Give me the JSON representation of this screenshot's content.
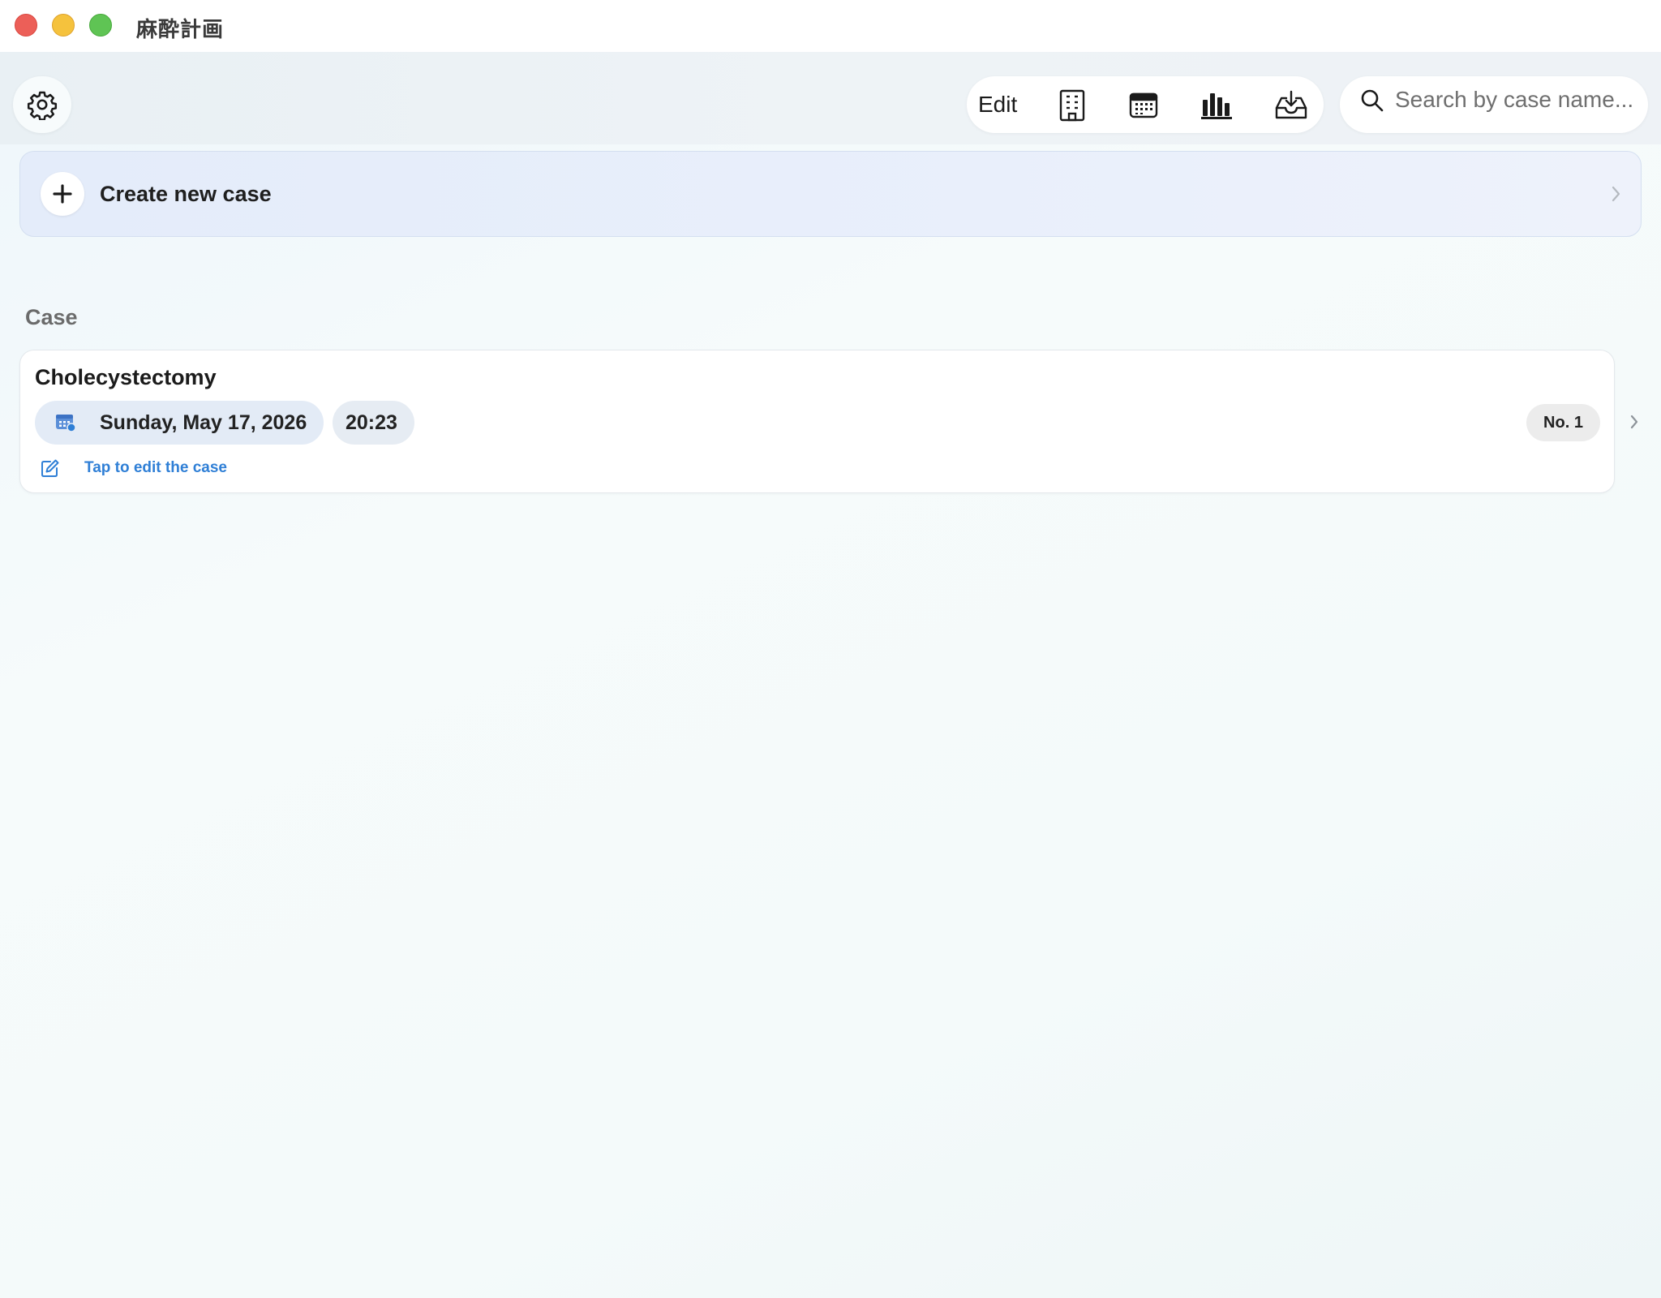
{
  "window": {
    "title": "麻酔計画"
  },
  "toolbar": {
    "edit_label": "Edit",
    "icons": [
      "settings-gear-icon",
      "building-icon",
      "calendar-icon",
      "bar-chart-icon",
      "inbox-download-icon"
    ]
  },
  "search": {
    "placeholder": "Search by case name..."
  },
  "create": {
    "label": "Create new case"
  },
  "section": {
    "header": "Case"
  },
  "cases": [
    {
      "title": "Cholecystectomy",
      "date": "Sunday, May 17, 2026",
      "time": "20:23",
      "number": "No. 1",
      "edit_hint": "Tap to edit the case"
    }
  ],
  "colors": {
    "accent": "#2f7fd6",
    "close": "#ec5f58",
    "minimize": "#f5c23d",
    "maximize": "#5fc454"
  }
}
